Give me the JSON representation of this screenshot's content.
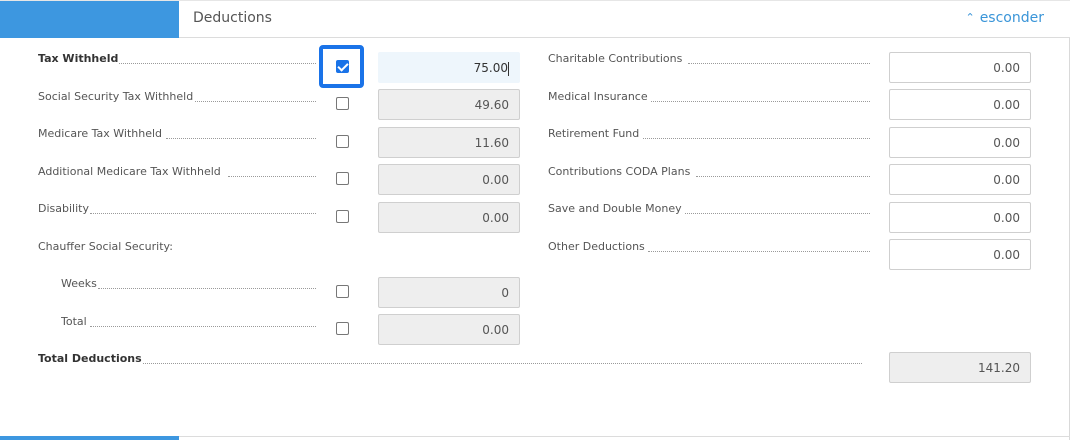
{
  "header": {
    "title": "Deductions",
    "toggle_label": "esconder",
    "toggle_icon": "chevron-up-icon"
  },
  "left": [
    {
      "key": "tax_withheld",
      "label": "Tax Withheld",
      "bold": true,
      "checked": true,
      "value": "75.00",
      "editable": true
    },
    {
      "key": "social_security",
      "label": "Social Security Tax Withheld",
      "checked": false,
      "value": "49.60"
    },
    {
      "key": "medicare",
      "label": "Medicare Tax Withheld",
      "checked": false,
      "value": "11.60"
    },
    {
      "key": "additional_medicare",
      "label": "Additional Medicare Tax Withheld",
      "checked": false,
      "value": "0.00"
    },
    {
      "key": "disability",
      "label": "Disability",
      "checked": false,
      "value": "0.00"
    },
    {
      "key": "chauffer",
      "label": "Chauffer Social Security:"
    },
    {
      "key": "weeks",
      "label": "Weeks",
      "checked": false,
      "value": "0"
    },
    {
      "key": "total",
      "label": "Total",
      "checked": false,
      "value": "0.00"
    }
  ],
  "right": [
    {
      "key": "charitable",
      "label": "Charitable Contributions",
      "value": "0.00"
    },
    {
      "key": "medical_insurance",
      "label": "Medical Insurance",
      "value": "0.00"
    },
    {
      "key": "retirement",
      "label": "Retirement Fund",
      "value": "0.00"
    },
    {
      "key": "coda",
      "label": "Contributions CODA Plans",
      "value": "0.00"
    },
    {
      "key": "save_double",
      "label": "Save and Double Money",
      "value": "0.00"
    },
    {
      "key": "other",
      "label": "Other Deductions",
      "value": "0.00"
    }
  ],
  "total_deductions": {
    "label": "Total Deductions",
    "value": "141.20"
  }
}
